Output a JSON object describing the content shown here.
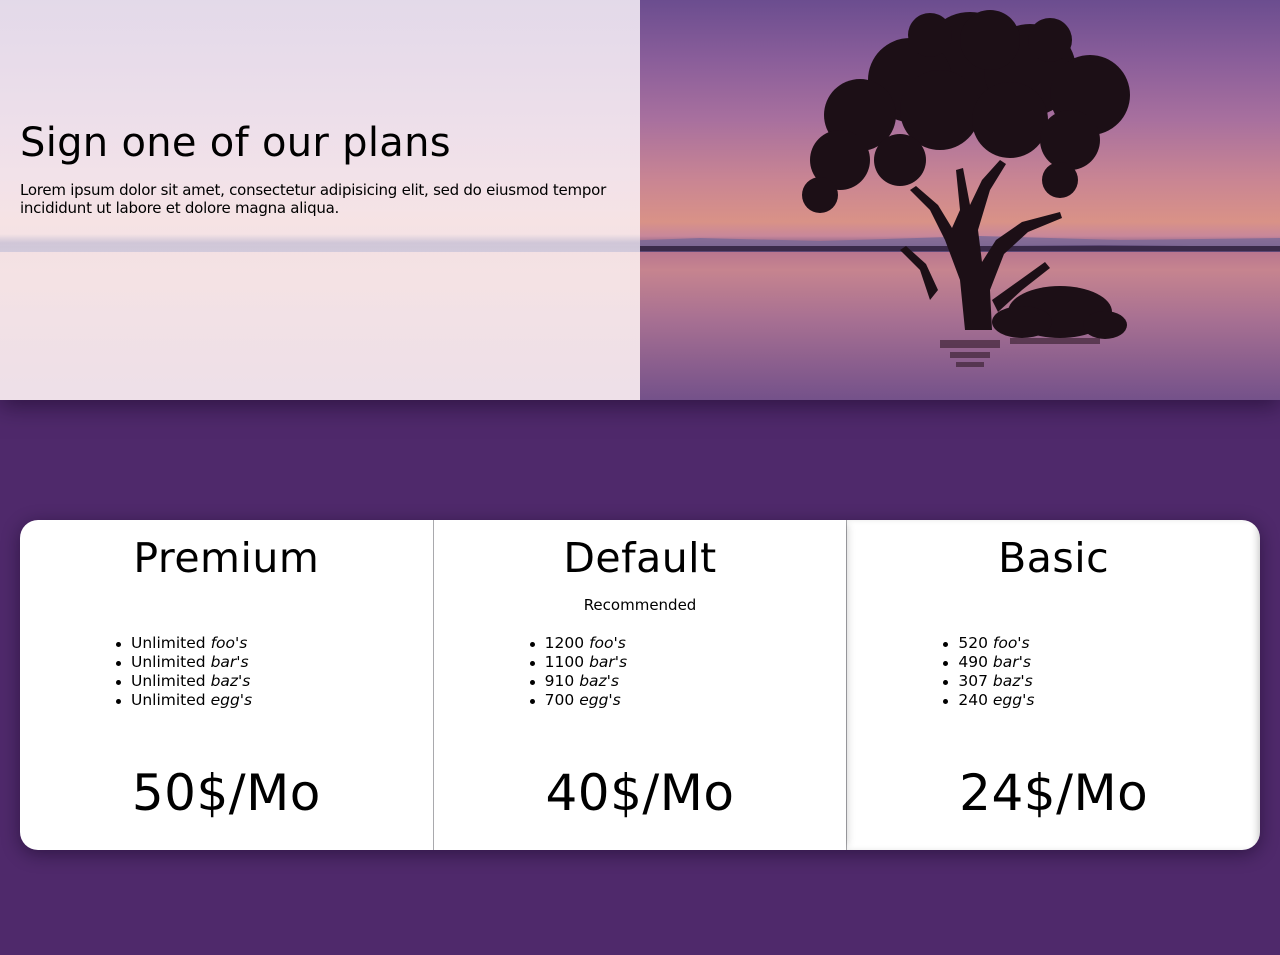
{
  "hero": {
    "title": "Sign one of our plans",
    "description": "Lorem ipsum dolor sit amet, consectetur adipisicing elit, sed do eiusmod tempor incididunt ut labore et dolore magna aliqua.",
    "image_alt": "lone tree standing in a calm lake at sunset"
  },
  "plans": [
    {
      "name": "Premium",
      "tag": "",
      "features": [
        {
          "qty": "Unlimited",
          "item": "foo's"
        },
        {
          "qty": "Unlimited",
          "item": "bar's"
        },
        {
          "qty": "Unlimited",
          "item": "baz's"
        },
        {
          "qty": "Unlimited",
          "item": "egg's"
        }
      ],
      "price": "50$/Mo"
    },
    {
      "name": "Default",
      "tag": "Recommended",
      "features": [
        {
          "qty": "1200",
          "item": "foo's"
        },
        {
          "qty": "1100",
          "item": "bar's"
        },
        {
          "qty": "910",
          "item": "baz's"
        },
        {
          "qty": "700",
          "item": "egg's"
        }
      ],
      "price": "40$/Mo"
    },
    {
      "name": "Basic",
      "tag": "",
      "features": [
        {
          "qty": "520",
          "item": "foo's"
        },
        {
          "qty": "490",
          "item": "bar's"
        },
        {
          "qty": "307",
          "item": "baz's"
        },
        {
          "qty": "240",
          "item": "egg's"
        }
      ],
      "price": "24$/Mo"
    }
  ],
  "colors": {
    "page_background": "#4f296b",
    "card_background": "#ffffff",
    "text": "#000000"
  }
}
